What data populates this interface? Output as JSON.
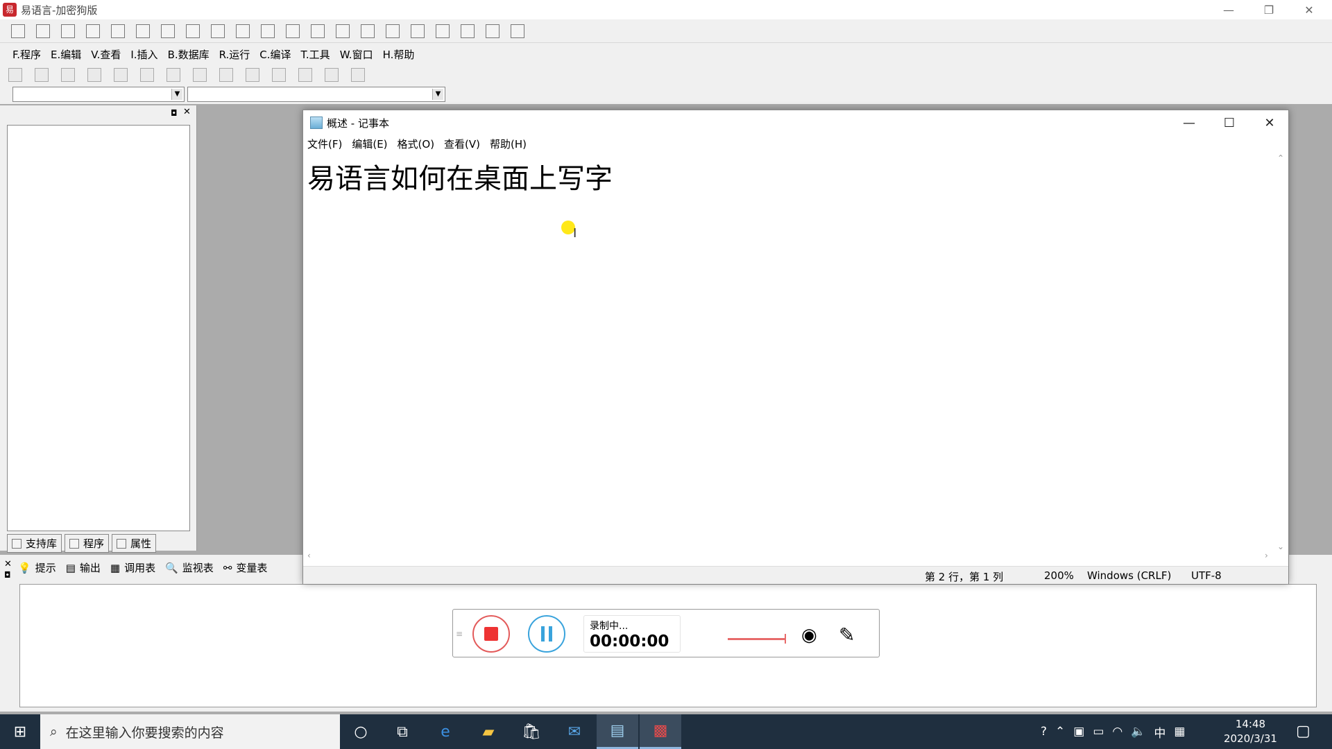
{
  "ide": {
    "title": "易语言-加密狗版",
    "menu": [
      "F.程序",
      "E.编辑",
      "V.查看",
      "I.插入",
      "B.数据库",
      "R.运行",
      "C.编译",
      "T.工具",
      "W.窗口",
      "H.帮助"
    ],
    "left_tabs": [
      "支持库",
      "程序",
      "属性"
    ],
    "bottom_tabs": [
      "提示",
      "输出",
      "调用表",
      "监视表",
      "变量表"
    ]
  },
  "notepad": {
    "title": "概述 - 记事本",
    "menu": [
      "文件(F)",
      "编辑(E)",
      "格式(O)",
      "查看(V)",
      "帮助(H)"
    ],
    "content": "易语言如何在桌面上写字",
    "status": {
      "position": "第 2 行，第 1 列",
      "zoom": "200%",
      "line_ending": "Windows (CRLF)",
      "encoding": "UTF-8"
    }
  },
  "recorder": {
    "status": "录制中...",
    "time": "00:00:00"
  },
  "taskbar": {
    "search_placeholder": "在这里输入你要搜索的内容",
    "ime": "中",
    "time": "14:48",
    "date": "2020/3/31"
  }
}
